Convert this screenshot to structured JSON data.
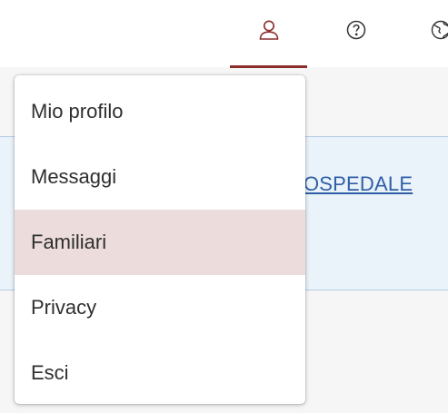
{
  "header": {
    "icons": [
      {
        "name": "user-icon"
      },
      {
        "name": "help-icon"
      },
      {
        "name": "globe-icon"
      }
    ],
    "accent_color": "#8a2d2b"
  },
  "content": {
    "hospital_link_text": "OSPEDALE"
  },
  "user_menu": {
    "items": [
      {
        "label": "Mio profilo"
      },
      {
        "label": "Messaggi"
      },
      {
        "label": "Familiari",
        "highlighted": true
      },
      {
        "label": "Privacy"
      },
      {
        "label": "Esci"
      }
    ],
    "highlight_color": "#ecdcdb"
  }
}
